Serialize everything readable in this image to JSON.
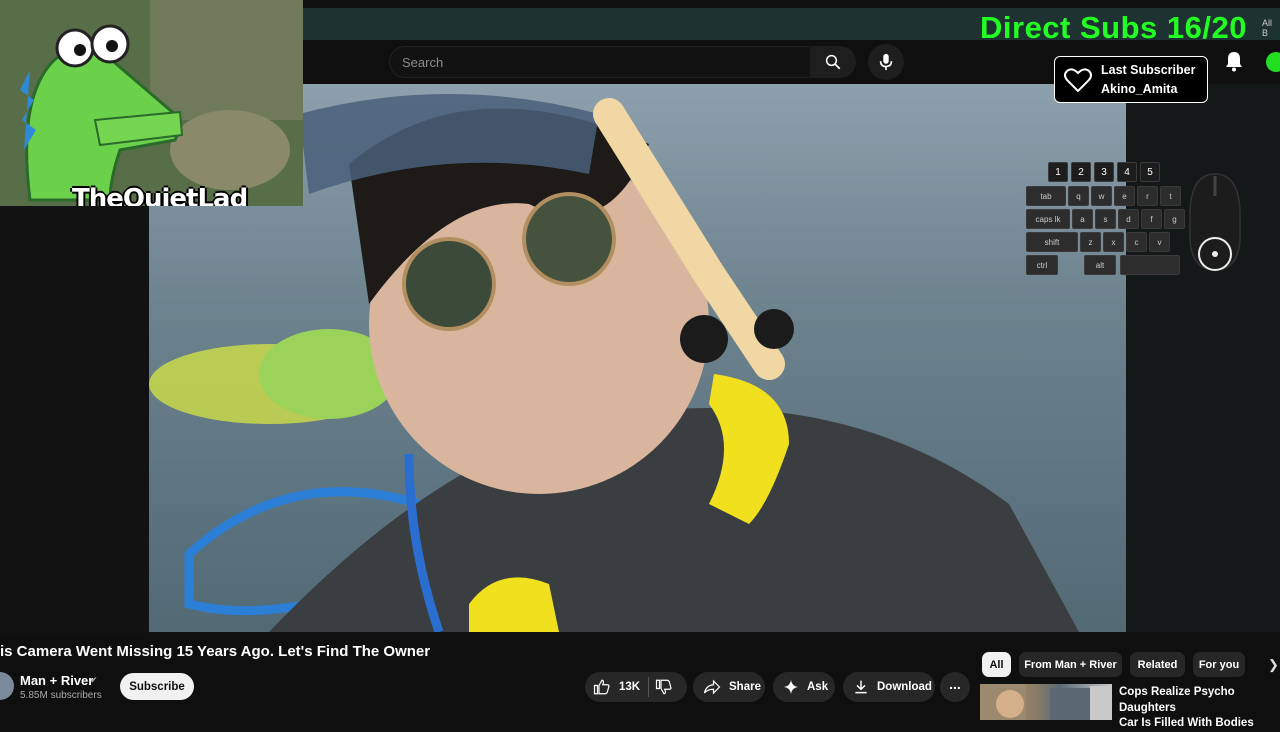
{
  "stream_overlay": {
    "direct_subs": "Direct Subs 16/20",
    "corner_text": "All B",
    "last_subscriber_label": "Last Subscriber",
    "last_subscriber_name": "Akino_Amita",
    "webcam_name": "TheQuietLad",
    "keyboard": {
      "number_keys": [
        "1",
        "2",
        "3",
        "4",
        "5"
      ],
      "row_tab": [
        "tab",
        "q",
        "w",
        "e",
        "r",
        "t"
      ],
      "row_caps": [
        "caps lk",
        "a",
        "s",
        "d",
        "f",
        "g"
      ],
      "row_shift": [
        "shift",
        "z",
        "x",
        "c",
        "v"
      ],
      "row_ctrl": [
        "ctrl",
        "alt"
      ]
    }
  },
  "header": {
    "search_placeholder": "Search"
  },
  "video": {
    "title": "is Camera Went Missing 15 Years Ago. Let's Find The Owner",
    "channel_name": "Man + River",
    "subscribers": "5.85M subscribers",
    "subscribe_label": "Subscribe",
    "likes": "13K",
    "share_label": "Share",
    "ask_label": "Ask",
    "download_label": "Download",
    "more_label": "..."
  },
  "sidebar": {
    "chips": [
      {
        "label": "All",
        "active": true
      },
      {
        "label": "From Man + River",
        "active": false
      },
      {
        "label": "Related",
        "active": false
      },
      {
        "label": "For you",
        "active": false
      }
    ],
    "recommendation_title_line1": "Cops Realize Psycho Daughters",
    "recommendation_title_line2": "Car Is Filled With Bodies"
  },
  "colors": {
    "overlay_green": "#22ff22",
    "background": "#0f0f0f",
    "chip_active": "#f1f1f1"
  }
}
